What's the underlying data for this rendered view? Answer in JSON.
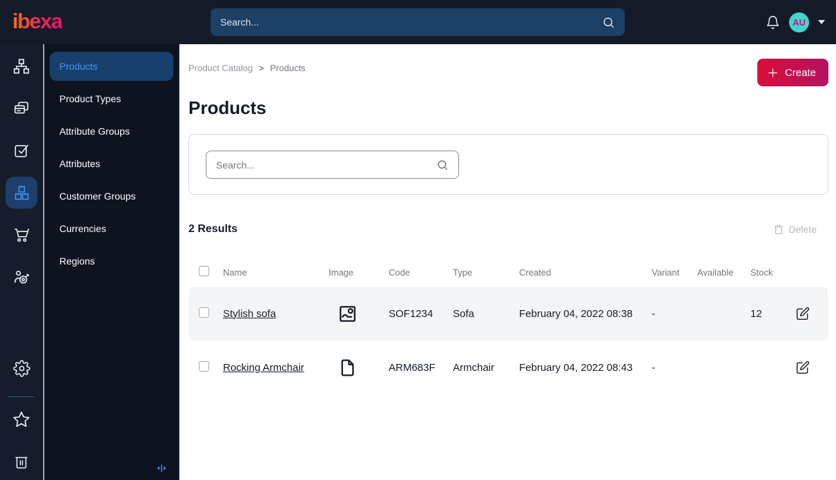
{
  "topbar": {
    "logo_text": "ibexa",
    "search_placeholder": "Search...",
    "avatar_initials": "AU",
    "icons": [
      "bell-icon",
      "search-icon",
      "chevron-down-icon"
    ]
  },
  "sidebar": {
    "icons": [
      {
        "name": "content-tree-icon",
        "active": false
      },
      {
        "name": "pages-icon",
        "active": false
      },
      {
        "name": "tasks-icon",
        "active": false
      },
      {
        "name": "product-catalog-icon",
        "active": true
      },
      {
        "name": "commerce-cart-icon",
        "active": false
      },
      {
        "name": "segments-icon",
        "active": false
      },
      {
        "name": "settings-gear-icon",
        "active": false
      },
      {
        "name": "bookmarks-star-icon",
        "active": false
      },
      {
        "name": "trash-icon",
        "active": false
      }
    ]
  },
  "menu": {
    "items": [
      {
        "label": "Products",
        "active": true
      },
      {
        "label": "Product Types",
        "active": false
      },
      {
        "label": "Attribute Groups",
        "active": false
      },
      {
        "label": "Attributes",
        "active": false
      },
      {
        "label": "Customer Groups",
        "active": false
      },
      {
        "label": "Currencies",
        "active": false
      },
      {
        "label": "Regions",
        "active": false
      }
    ]
  },
  "main": {
    "breadcrumb": {
      "items": [
        "Product Catalog",
        "Products"
      ],
      "separator": ">"
    },
    "create_label": "Create",
    "title": "Products",
    "filter_search_placeholder": "Search...",
    "results_label": "2 Results",
    "delete_label": "Delete",
    "table": {
      "headers": [
        "Name",
        "Image",
        "Code",
        "Type",
        "Created",
        "Variant",
        "Available",
        "Stock"
      ],
      "rows": [
        {
          "name": "Stylish sofa",
          "image_icon": "image-icon",
          "code": "SOF1234",
          "type": "Sofa",
          "created": "February 04, 2022 08:38",
          "variant": "-",
          "available": true,
          "available_color": "#00a42e",
          "stock": "12"
        },
        {
          "name": "Rocking Armchair",
          "image_icon": "file-icon",
          "code": "ARM683F",
          "type": "Armchair",
          "created": "February 04, 2022 08:43",
          "variant": "-",
          "available": false,
          "available_color": "#b1b5bb",
          "stock": ""
        }
      ]
    }
  },
  "colors": {
    "topbar_bg": "#141a28",
    "rail_bg": "#161c2b",
    "menu_bg": "#0e131f",
    "accent_blue": "#3f8df5",
    "active_item_bg": "#16406b",
    "brand_gradient_start": "#dc0e3c",
    "brand_gradient_end": "#b2125f",
    "avatar_bg": "#41d6cd",
    "avatar_text": "#d0127a",
    "available_green": "#00a42e",
    "unavailable_gray": "#b1b5bb",
    "row_shade": "#f4f5f7"
  }
}
